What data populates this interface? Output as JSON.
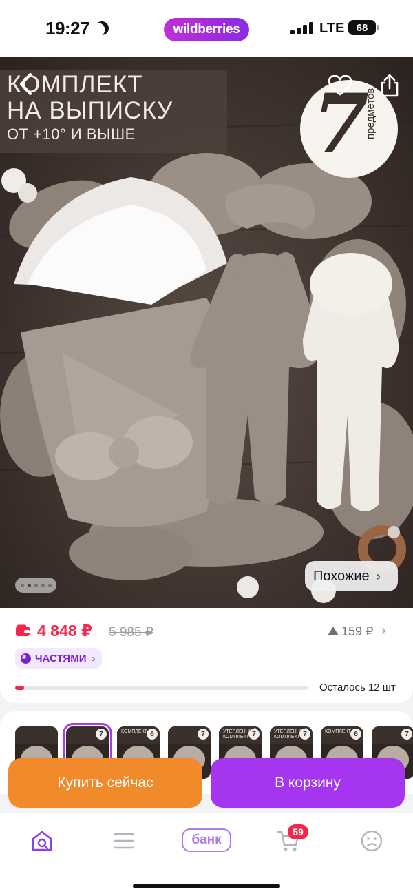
{
  "status_bar": {
    "time": "19:27",
    "brand": "wildberries",
    "network": "LTE",
    "battery": "68"
  },
  "hero": {
    "headline_line1": "КОМПЛЕКТ",
    "headline_line2": "НА ВЫПИСКУ",
    "headline_line3": "ОТ +10° И ВЫШЕ",
    "badge_number": "7",
    "badge_text": "предметов",
    "similar_label": "Похожие",
    "pager_count": 5,
    "pager_active": 1
  },
  "price": {
    "current": "4 848 ₽",
    "old": "5 985 ₽",
    "delta": "159 ₽",
    "installments_label": "ЧАСТЯМИ",
    "stock_label": "Осталось 12 шт",
    "stock_fraction": 0.03
  },
  "variants": [
    {
      "lines": "",
      "num": "",
      "selected": false
    },
    {
      "lines": "",
      "num": "7",
      "selected": true
    },
    {
      "lines": "КОМПЛЕКТ",
      "num": "6",
      "selected": false
    },
    {
      "lines": "",
      "num": "7",
      "selected": false
    },
    {
      "lines": "УТЕПЛЕННЫЙ КОМПЛЕКТ",
      "num": "7",
      "selected": false
    },
    {
      "lines": "УТЕПЛЕННЫЙ КОМПЛЕКТ",
      "num": "7",
      "selected": false
    },
    {
      "lines": "КОМПЛЕКТ",
      "num": "6",
      "selected": false
    },
    {
      "lines": "",
      "num": "7",
      "selected": false
    }
  ],
  "actions": {
    "buy_now": "Купить сейчас",
    "add_to_cart": "В корзину"
  },
  "bottom_nav": {
    "bank_label": "банк",
    "cart_count": "59",
    "icons": [
      "home-search-icon",
      "menu-icon",
      "bank-logo",
      "cart-icon",
      "profile-icon"
    ]
  },
  "colors": {
    "price_red": "#f5264a",
    "brand_purple": "#a535ee",
    "buy_orange": "#f08a2a"
  }
}
